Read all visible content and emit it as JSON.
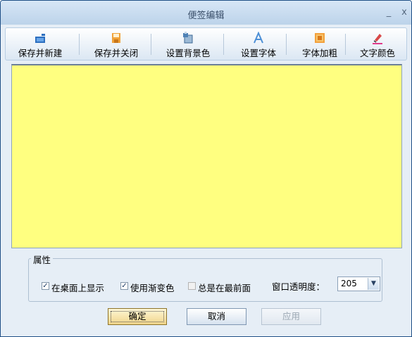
{
  "window": {
    "title": "便签编辑",
    "minimize": "_",
    "close": "x"
  },
  "toolbar": {
    "items": [
      {
        "label": "保存并新建",
        "icon": "save-new-icon"
      },
      {
        "label": "保存并关闭",
        "icon": "save-close-icon"
      },
      {
        "label": "设置背景色",
        "icon": "background-color-icon"
      },
      {
        "label": "设置字体",
        "icon": "font-icon"
      },
      {
        "label": "字体加粗",
        "icon": "bold-icon"
      },
      {
        "label": "文字颜色",
        "icon": "text-color-icon"
      }
    ]
  },
  "editor": {
    "background": "#ffff80",
    "text": ""
  },
  "properties": {
    "title": "属性",
    "show_on_desktop": {
      "label": "在桌面上显示",
      "checked": true
    },
    "use_gradient": {
      "label": "使用渐变色",
      "checked": true
    },
    "always_on_top": {
      "label": "总是在最前面",
      "checked": false
    },
    "opacity_label": "窗口透明度：",
    "opacity_value": "205"
  },
  "buttons": {
    "ok": "确定",
    "cancel": "取消",
    "apply": "应用"
  }
}
